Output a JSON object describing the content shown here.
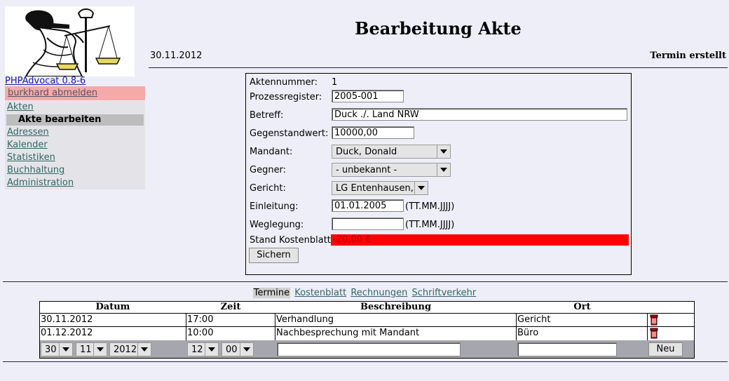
{
  "sidebar": {
    "app_version_link": "PHPAdvocat 0.8-6",
    "logout_label": "burkhard abmelden",
    "nav": {
      "akten": "Akten",
      "akte_bearbeiten": "Akte bearbeiten",
      "adressen": "Adressen",
      "kalender": "Kalender",
      "statistiken": "Statistiken",
      "buchhaltung": "Buchhaltung",
      "administration": "Administration"
    }
  },
  "header": {
    "title": "Bearbeitung Akte",
    "date": "30.11.2012",
    "status": "Termin erstellt"
  },
  "form": {
    "aktennummer_label": "Aktennummer:",
    "aktennummer_value": "1",
    "prozessregister_label": "Prozessregister:",
    "prozessregister_value": "2005-001",
    "betreff_label": "Betreff:",
    "betreff_value": "Duck ./. Land NRW",
    "gegenstandwert_label": "Gegenstandwert:",
    "gegenstandwert_value": "10000,00",
    "mandant_label": "Mandant:",
    "mandant_value": "Duck, Donald",
    "gegner_label": "Gegner:",
    "gegner_value": "- unbekannt -",
    "gericht_label": "Gericht:",
    "gericht_value": "LG Entenhausen,",
    "einleitung_label": "Einleitung:",
    "einleitung_value": "01.01.2005",
    "einleitung_hint": "(TT.MM.JJJJ)",
    "weglegung_label": "Weglegung:",
    "weglegung_value": "",
    "weglegung_hint": "(TT.MM.JJJJ)",
    "kostenblatt_label": "Stand Kostenblatt:",
    "kostenblatt_value": "-20,00 €",
    "save_label": "Sichern"
  },
  "tabs": {
    "termine": "Termine",
    "kostenblatt": "Kostenblatt",
    "rechnungen": "Rechnungen",
    "schriftverkehr": "Schriftverkehr"
  },
  "table": {
    "headers": {
      "datum": "Datum",
      "zeit": "Zeit",
      "beschreibung": "Beschreibung",
      "ort": "Ort"
    },
    "rows": [
      {
        "datum": "30.11.2012",
        "zeit": "17:00",
        "beschreibung": "Verhandlung",
        "ort": "Gericht"
      },
      {
        "datum": "01.12.2012",
        "zeit": "10:00",
        "beschreibung": "Nachbesprechung mit Mandant",
        "ort": "Büro"
      }
    ],
    "new_entry": {
      "day": "30",
      "month": "11",
      "year": "2012",
      "hour": "12",
      "minute": "00",
      "beschreibung": "",
      "ort": "",
      "button_label": "Neu"
    }
  },
  "colors": {
    "background": "#eeeef8",
    "logout_bg": "#f5a9a9",
    "kostenblatt_bg": "#ff0000",
    "link": "#336666"
  },
  "icons": {
    "delete": "trash-icon",
    "logo": "justitia-logo"
  }
}
